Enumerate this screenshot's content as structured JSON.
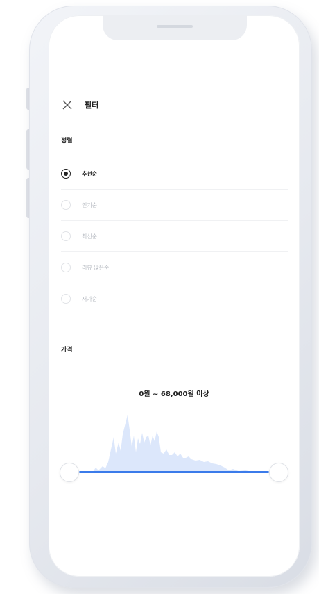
{
  "header": {
    "title": "필터",
    "close_icon": "close-icon"
  },
  "sort": {
    "label": "정렬",
    "options": [
      {
        "label": "추천순",
        "selected": true
      },
      {
        "label": "인기순",
        "selected": false
      },
      {
        "label": "최신순",
        "selected": false
      },
      {
        "label": "리뷰 많은순",
        "selected": false
      },
      {
        "label": "저가순",
        "selected": false
      }
    ]
  },
  "price": {
    "label": "가격",
    "range_text": "0원 ~ 68,000원 이상",
    "min_value": 0,
    "max_value": 68000
  },
  "colors": {
    "accent": "#3b7bea",
    "histogram_fill": "#dce7fb",
    "text_primary": "#222222",
    "text_muted": "#b8bcc3"
  }
}
